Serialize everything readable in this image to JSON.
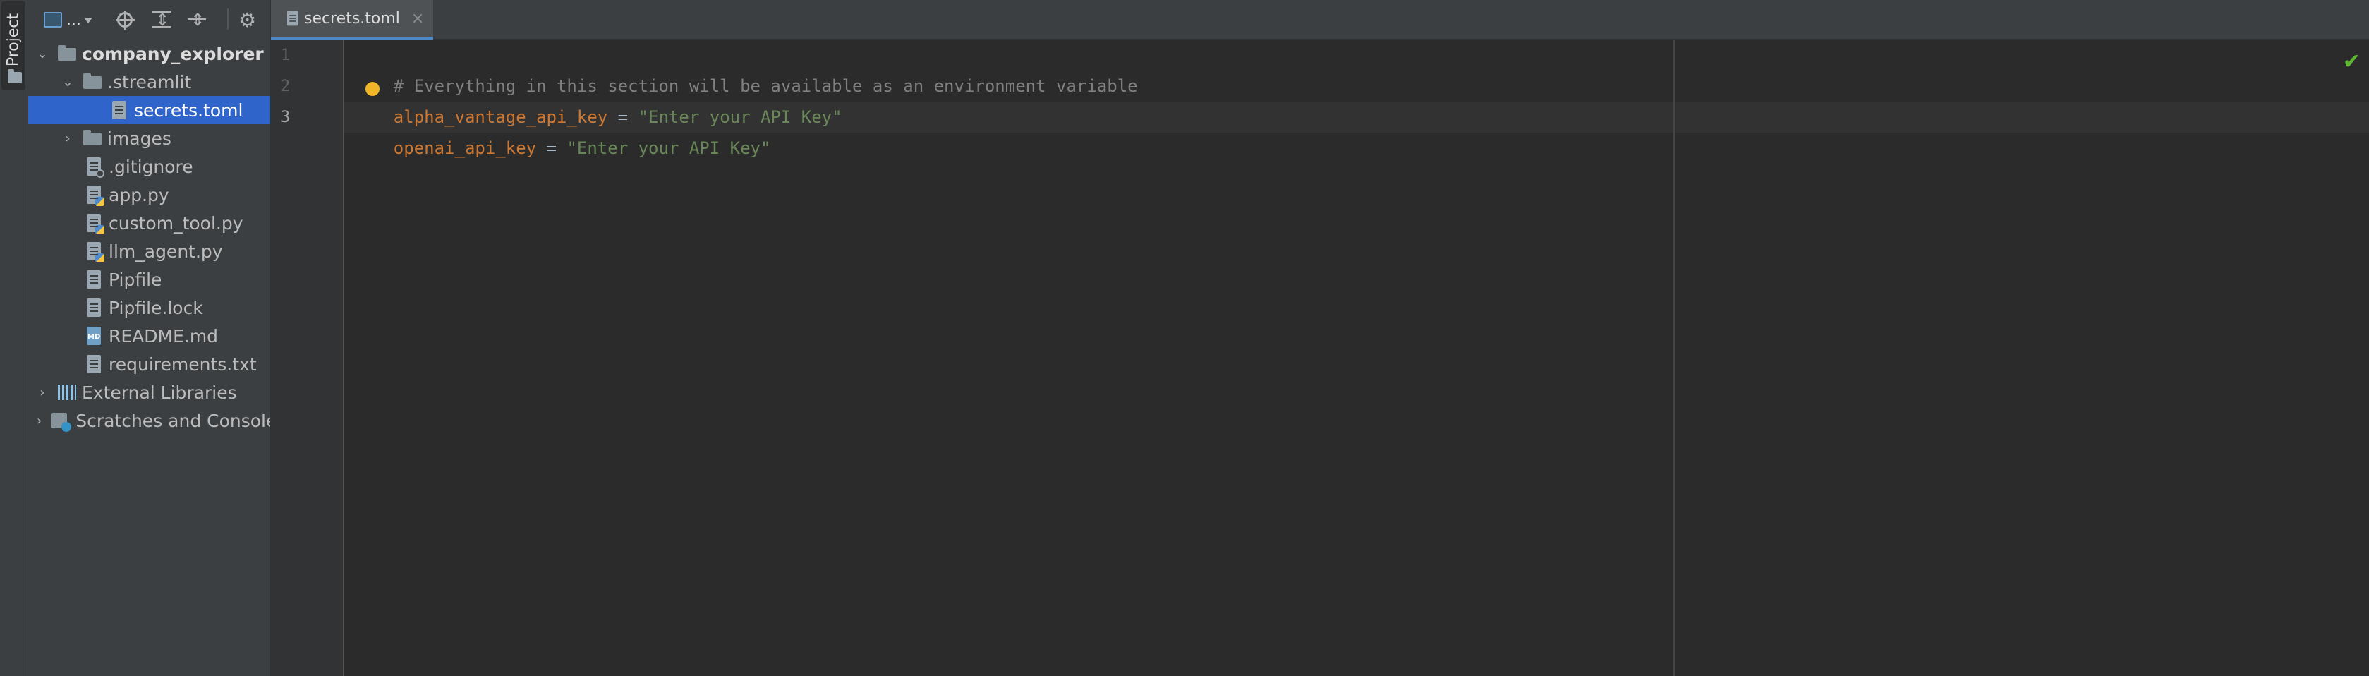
{
  "sidebar_stripe": {
    "label": "Project"
  },
  "project_toolbar": {
    "view_selector_label": "..."
  },
  "tree": {
    "root": "company_explorer",
    "streamlit_folder": ".streamlit",
    "secrets_file": "secrets.toml",
    "images_folder": "images",
    "files": [
      ".gitignore",
      "app.py",
      "custom_tool.py",
      "llm_agent.py",
      "Pipfile",
      "Pipfile.lock",
      "README.md",
      "requirements.txt"
    ],
    "external_libraries": "External Libraries",
    "scratches": "Scratches and Consoles"
  },
  "editor_tab": {
    "label": "secrets.toml",
    "close": "×"
  },
  "editor": {
    "line_numbers": [
      "1",
      "2",
      "3"
    ],
    "line1_comment": "# Everything in this section will be available as an environment variable",
    "line2_key": "alpha_vantage_api_key",
    "line2_eq": " = ",
    "line2_value": "\"Enter your API Key\"",
    "line3_key": "openai_api_key",
    "line3_eq": " = ",
    "line3_value": "\"Enter your API Key\""
  },
  "colors": {
    "selection": "#2f65ca",
    "key": "#cc7832",
    "string": "#6a8759",
    "comment": "#808080"
  }
}
